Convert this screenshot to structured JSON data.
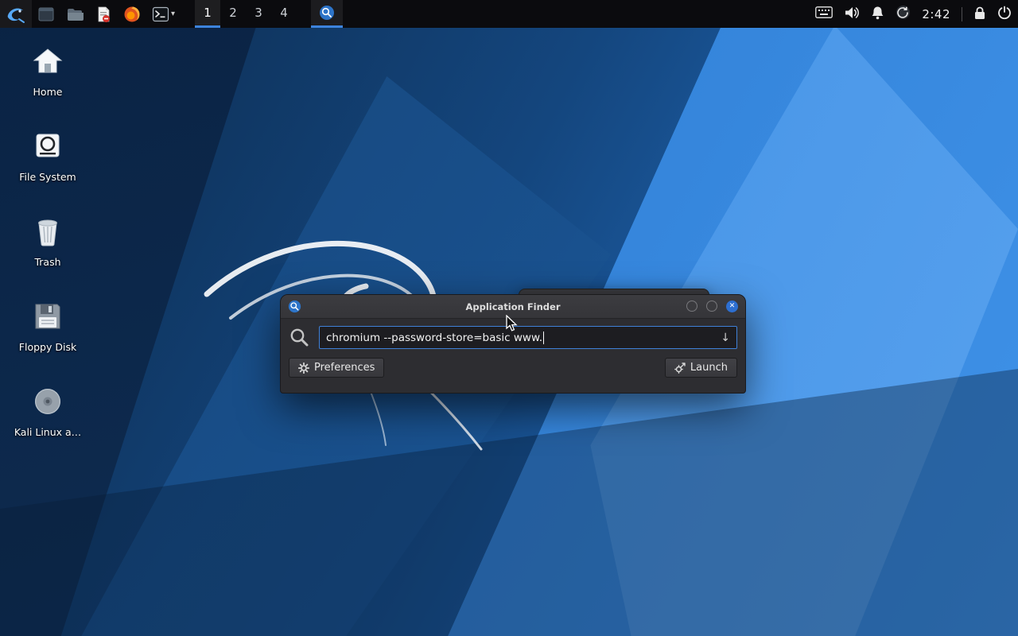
{
  "panel": {
    "workspaces": [
      "1",
      "2",
      "3",
      "4"
    ],
    "active_workspace": "1",
    "clock": "2:42",
    "taskbar_app": "Application Finder",
    "terminal_caret": "▾"
  },
  "desktop": {
    "icons": [
      {
        "label": "Home"
      },
      {
        "label": "File System"
      },
      {
        "label": "Trash"
      },
      {
        "label": "Floppy Disk"
      },
      {
        "label": "Kali Linux a…"
      }
    ]
  },
  "finder": {
    "title": "Application Finder",
    "query": "chromium --password-store=basic www.",
    "preferences_label": "Preferences",
    "launch_label": "Launch",
    "dropdown_arrow": "↓"
  },
  "colors": {
    "accent": "#3d84dd",
    "close_button": "#2d6fd1",
    "panel_background": "#0b0b0e"
  }
}
